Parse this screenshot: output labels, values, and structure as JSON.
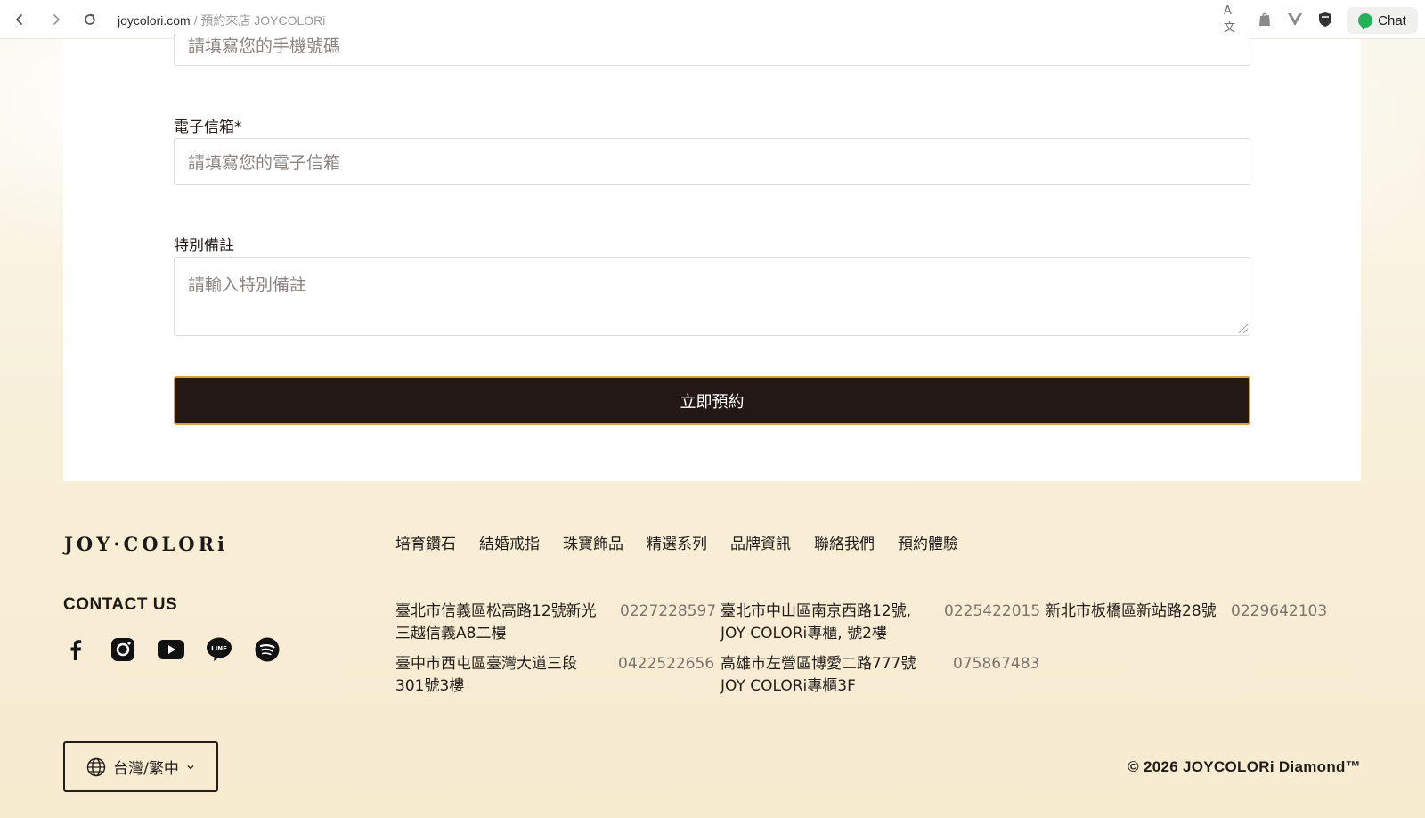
{
  "browser": {
    "domain": "joycolori.com",
    "separator": "/",
    "tab_title": "預約來店 JOYCOLORi",
    "translate_icon_glyph": "A文",
    "chat_label": "Chat"
  },
  "form": {
    "phone": {
      "placeholder": "請填寫您的手機號碼"
    },
    "email": {
      "label": "電子信箱*",
      "placeholder": "請填寫您的電子信箱"
    },
    "notes": {
      "label": "特別備註",
      "placeholder": "請輸入特別備註"
    },
    "submit_label": "立即預約"
  },
  "footer": {
    "logo": "JOY·COLORi",
    "nav": [
      "培育鑽石",
      "結婚戒指",
      "珠寶飾品",
      "精選系列",
      "品牌資訊",
      "聯絡我們",
      "預約體驗"
    ],
    "contact_title": "CONTACT US",
    "social": [
      "facebook-icon",
      "instagram-icon",
      "youtube-icon",
      "line-icon",
      "spotify-icon"
    ],
    "stores": [
      {
        "address_line1": "臺北市信義區松高路12號新光",
        "address_line2": "三越信義A8二樓",
        "phone": "0227228597"
      },
      {
        "address_line1": "臺北市中山區南京西路12號,",
        "address_line2": "JOY COLORi專櫃, 號2樓",
        "phone": "0225422015"
      },
      {
        "address_line1": "新北市板橋區新站路28號",
        "address_line2": "",
        "phone": "0229642103"
      },
      {
        "address_line1": "臺中市西屯區臺灣大道三段",
        "address_line2": "301號3樓",
        "phone": "0422522656"
      },
      {
        "address_line1": "高雄市左營區博愛二路777號",
        "address_line2": "JOY COLORi專櫃3F",
        "phone": "075867483"
      }
    ],
    "language": "台灣/繁中",
    "copyright": "© 2026 JOYCOLORi Diamond™"
  },
  "colors": {
    "button_bg": "#231815",
    "button_border": "#d1a44a",
    "chat_green": "#22b35a"
  }
}
